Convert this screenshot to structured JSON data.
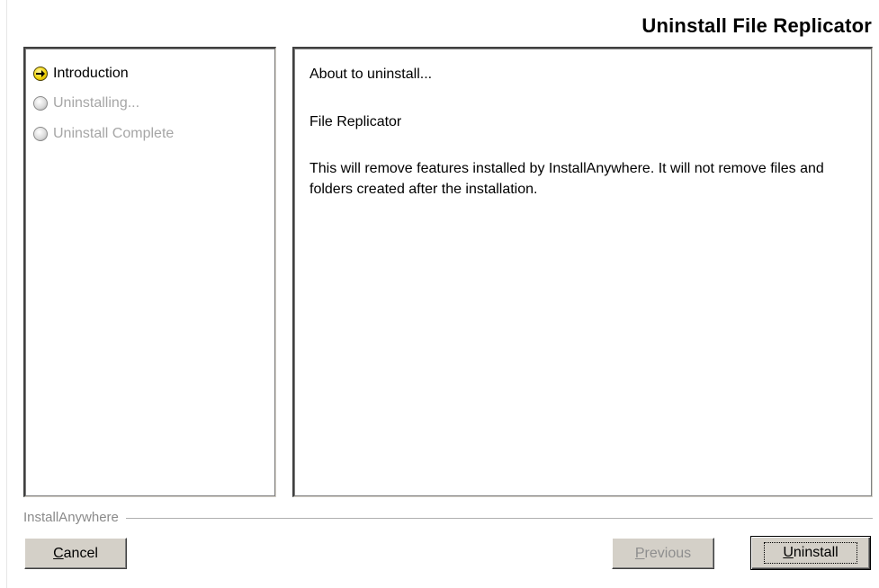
{
  "window": {
    "title": "Uninstall File Replicator"
  },
  "steps": [
    {
      "label": "Introduction",
      "state": "active",
      "icon": "arrow-right-icon"
    },
    {
      "label": "Uninstalling...",
      "state": "pending",
      "icon": "pending-circle-icon"
    },
    {
      "label": "Uninstall Complete",
      "state": "pending",
      "icon": "pending-circle-icon"
    }
  ],
  "content": {
    "heading": "About to uninstall...",
    "product": "File Replicator",
    "message": "This will remove features installed by InstallAnywhere.  It will not remove files and folders created after the installation."
  },
  "footer": {
    "brand": "InstallAnywhere"
  },
  "buttons": {
    "cancel": {
      "mnemonic": "C",
      "rest": "ancel"
    },
    "previous": {
      "mnemonic": "P",
      "rest": "revious",
      "enabled": false
    },
    "uninstall": {
      "mnemonic": "U",
      "rest": "ninstall",
      "default": true
    }
  },
  "colors": {
    "active_icon": "#f3d60a",
    "disabled_text": "#a6a6a6",
    "button_face": "#d4d0c8"
  }
}
